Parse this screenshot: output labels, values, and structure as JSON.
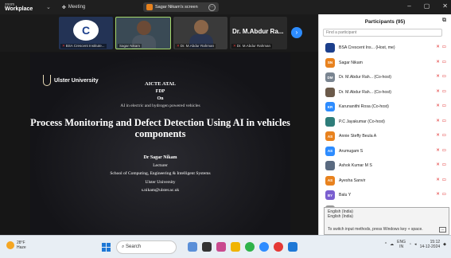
{
  "titlebar": {
    "logo_line1": "zoom",
    "logo_line2": "Workplace",
    "meeting_label": "Meeting",
    "share_label": "Sagar Nikam's screen",
    "minimize": "–",
    "maximize": "▢",
    "close": "✕"
  },
  "thumbnails": [
    {
      "name": "BSA Crescent Institute..."
    },
    {
      "name": "Sagar Nikam"
    },
    {
      "name": "Dr. M.Abdur Rahman"
    },
    {
      "name": "Dr. M.Abdur Rahman",
      "big": "Dr. M.Abdur Ra..."
    }
  ],
  "slide": {
    "logo_text": "Ulster University",
    "aicte": "AICTE ATAL",
    "fdp": "FDP",
    "on": "On",
    "subtitle": "AI in electric and hydrogen powered vehicles",
    "title": "Process Monitoring and Defect Detection Using AI in vehicles components",
    "presenter": "Dr Sagar Nikam",
    "role": "Lecturer",
    "school": "School of Computing, Engineering & Intelligent Systems",
    "university": "Ulster University",
    "email": "s.nikam@ulster.ac.uk"
  },
  "participants": {
    "header": "Participants (95)",
    "search_placeholder": "Find a participant",
    "list": [
      {
        "initials": "",
        "color": "#1c3f8c",
        "name": "BSA Crescent Ins... (Host, me)"
      },
      {
        "initials": "SN",
        "color": "#e8821e",
        "name": "Sagar Nikam"
      },
      {
        "initials": "DM",
        "color": "#7a8591",
        "name": "Dr. M.Abdur Rah... (Co-host)"
      },
      {
        "initials": "",
        "color": "#6b5a4a",
        "name": "Dr. M.Abdur Rah... (Co-host)"
      },
      {
        "initials": "KR",
        "color": "#2d8cff",
        "name": "Karunanithi Rosa (Co-host)"
      },
      {
        "initials": "",
        "color": "#2e7d7a",
        "name": "P.C Jayakumar (Co-host)"
      },
      {
        "initials": "AS",
        "color": "#e8821e",
        "name": "Annie Steffy Beula A"
      },
      {
        "initials": "AS",
        "color": "#2d8cff",
        "name": "Arumugam S"
      },
      {
        "initials": "",
        "color": "#5a6a80",
        "name": "Ashok Kumar M S"
      },
      {
        "initials": "AS",
        "color": "#e8821e",
        "name": "Ayesha Sanvir"
      },
      {
        "initials": "BY",
        "color": "#7b5fd0",
        "name": "Balu Y"
      },
      {
        "initials": "",
        "color": "#999999",
        "name": ""
      }
    ]
  },
  "ime": {
    "line1": "English (India)",
    "line2": "English (India)",
    "hint": "To switch input methods, press Windows key + space.",
    "dots": "..."
  },
  "taskbar": {
    "temp": "28°F",
    "weather": "Haze",
    "search": "Search",
    "lang1": "ENG",
    "lang2": "IN",
    "time": "15:12",
    "date": "14-12-2024"
  }
}
